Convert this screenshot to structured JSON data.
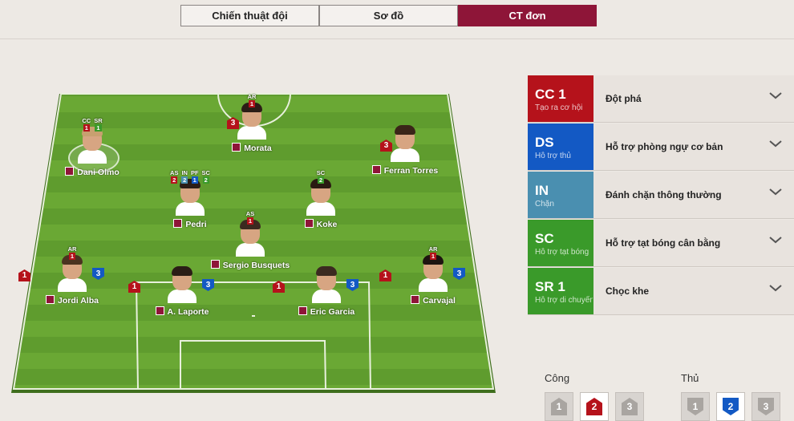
{
  "tabs": [
    {
      "label": "Chiến thuật đội",
      "active": false
    },
    {
      "label": "Sơ đồ",
      "active": false
    },
    {
      "label": "CT đơn",
      "active": true
    }
  ],
  "players": [
    {
      "name": "Morata",
      "atk": "3",
      "def": null,
      "roles": [
        {
          "code": "AR",
          "level": "1",
          "color": "#b5121b"
        }
      ]
    },
    {
      "name": "Dani Olmo",
      "atk": null,
      "def": null,
      "selected": true,
      "roles": [
        {
          "code": "CC",
          "level": "1",
          "color": "#b5121b"
        },
        {
          "code": "SR",
          "level": "1",
          "color": "#3a9a2a"
        }
      ]
    },
    {
      "name": "Ferran Torres",
      "atk": "3",
      "def": null,
      "roles": []
    },
    {
      "name": "Pedri",
      "atk": null,
      "def": null,
      "roles": [
        {
          "code": "AS",
          "level": "2",
          "color": "#b5121b"
        },
        {
          "code": "IN",
          "level": "2",
          "color": "#4a8fb0"
        },
        {
          "code": "PF",
          "level": "1",
          "color": "#1359c4"
        },
        {
          "code": "SC",
          "level": "2",
          "color": "#3a9a2a"
        }
      ]
    },
    {
      "name": "Koke",
      "atk": null,
      "def": null,
      "roles": [
        {
          "code": "SC",
          "level": "2",
          "color": "#3a9a2a"
        }
      ]
    },
    {
      "name": "Sergio Busquets",
      "atk": null,
      "def": null,
      "roles": [
        {
          "code": "AS",
          "level": "1",
          "color": "#b5121b"
        }
      ]
    },
    {
      "name": "Jordi Alba",
      "atk": "1",
      "def": "3",
      "roles": [
        {
          "code": "AR",
          "level": "1",
          "color": "#b5121b"
        }
      ]
    },
    {
      "name": "A. Laporte",
      "atk": "1",
      "def": "3",
      "roles": []
    },
    {
      "name": "Eric Garcia",
      "atk": "1",
      "def": "3",
      "roles": []
    },
    {
      "name": "Carvajal",
      "atk": "1",
      "def": "3",
      "roles": [
        {
          "code": "AR",
          "level": "1",
          "color": "#b5121b"
        }
      ]
    }
  ],
  "instructions": [
    {
      "code": "CC 1",
      "subtitle": "Tạo ra cơ hội",
      "value": "Đột phá",
      "color": "#b5121b"
    },
    {
      "code": "DS",
      "subtitle": "Hỗ trợ thủ",
      "value": "Hỗ trợ phòng ngự cơ bản",
      "color": "#1359c4"
    },
    {
      "code": "IN",
      "subtitle": "Chặn",
      "value": "Đánh chặn thông thường",
      "color": "#4a8fb0"
    },
    {
      "code": "SC",
      "subtitle": "Hỗ trợ tạt bóng",
      "value": "Hỗ trợ tạt bóng cân bằng",
      "color": "#3a9a2a"
    },
    {
      "code": "SR 1",
      "subtitle": "Hỗ trợ di chuyển",
      "value": "Chọc khe",
      "color": "#3a9a2a"
    }
  ],
  "attack": {
    "label": "Công",
    "levels": [
      "1",
      "2",
      "3"
    ],
    "selected": "2"
  },
  "defense": {
    "label": "Thủ",
    "levels": [
      "1",
      "2",
      "3"
    ],
    "selected": "2"
  }
}
